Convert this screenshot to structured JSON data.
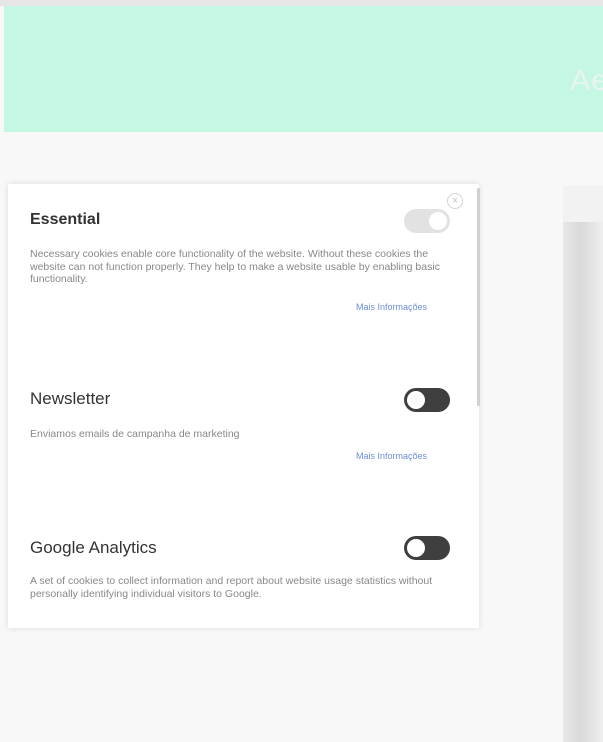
{
  "banner": {
    "text": "Ae"
  },
  "modal": {
    "close_icon": "close-icon",
    "sections": [
      {
        "title": "Essential",
        "description": "Necessary cookies enable core functionality of the website. Without these cookies the website can not function properly. They help to make a website usable by enabling basic functionality.",
        "more_link": "Mais Informações",
        "toggle_on": true,
        "toggle_disabled": true
      },
      {
        "title": "Newsletter",
        "description": "Enviamos emails de campanha de marketing",
        "more_link": "Mais Informações",
        "toggle_on": false
      },
      {
        "title": "Google Analytics",
        "description": "A set of cookies to collect information and report about website usage statistics without personally identifying individual visitors to Google.",
        "toggle_on": false
      }
    ]
  },
  "colors": {
    "banner_bg": "#c5f8e3",
    "toggle_off": "#3f3f3f",
    "toggle_disabled": "#d9d9d9",
    "link": "#6b8ed6"
  }
}
